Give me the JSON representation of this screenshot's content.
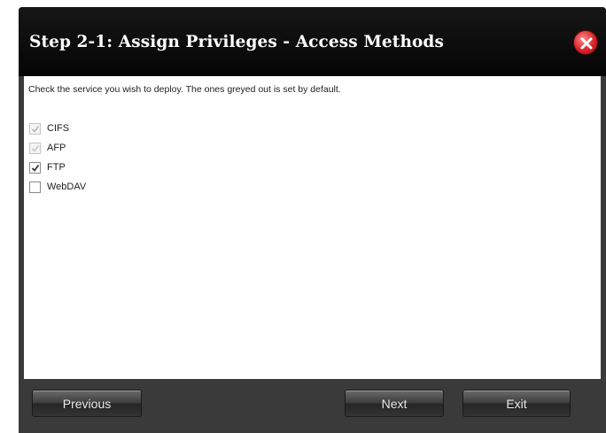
{
  "dialog": {
    "title": "Step 2-1: Assign Privileges - Access Methods",
    "close_icon": "close-icon",
    "instruction": "Check the service you wish to deploy. The ones greyed out is set by default.",
    "options": [
      {
        "label": "CIFS",
        "checked": true,
        "disabled": true
      },
      {
        "label": "AFP",
        "checked": false,
        "disabled": true
      },
      {
        "label": "FTP",
        "checked": true,
        "disabled": false
      },
      {
        "label": "WebDAV",
        "checked": false,
        "disabled": false
      }
    ],
    "buttons": {
      "previous": "Previous",
      "next": "Next",
      "exit": "Exit"
    }
  },
  "colors": {
    "titlebar": "#050505",
    "frame": "#3a3a3a",
    "close": "#d8242a"
  }
}
